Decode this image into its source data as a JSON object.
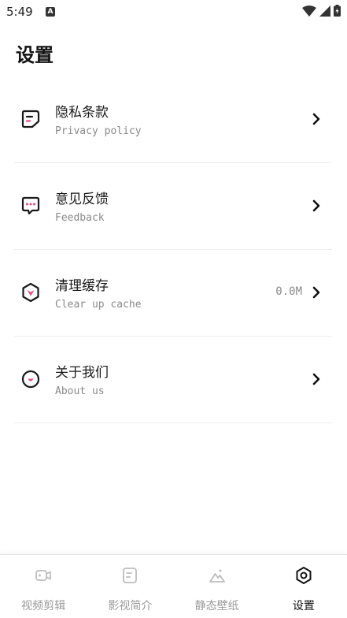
{
  "status_bar": {
    "time": "5:49",
    "notification_badge": "A"
  },
  "page": {
    "title": "设置"
  },
  "menu": [
    {
      "title": "隐私条款",
      "subtitle": "Privacy policy",
      "value": "",
      "icon": "document-icon"
    },
    {
      "title": "意见反馈",
      "subtitle": "Feedback",
      "value": "",
      "icon": "chat-icon"
    },
    {
      "title": "清理缓存",
      "subtitle": "Clear up cache",
      "value": "0.0M",
      "icon": "clean-icon"
    },
    {
      "title": "关于我们",
      "subtitle": "About us",
      "value": "",
      "icon": "smile-icon"
    }
  ],
  "bottom_nav": {
    "tabs": [
      {
        "label": "视频剪辑",
        "icon": "video-edit-icon",
        "active": false
      },
      {
        "label": "影视简介",
        "icon": "film-info-icon",
        "active": false
      },
      {
        "label": "静态壁纸",
        "icon": "wallpaper-icon",
        "active": false
      },
      {
        "label": "设置",
        "icon": "settings-icon",
        "active": true
      }
    ]
  },
  "colors": {
    "accent": "#e94a7a",
    "text_primary": "#1a1a1a",
    "text_secondary": "#8a8a8a",
    "divider": "#eeeeee",
    "nav_inactive": "#9a9a9a"
  }
}
